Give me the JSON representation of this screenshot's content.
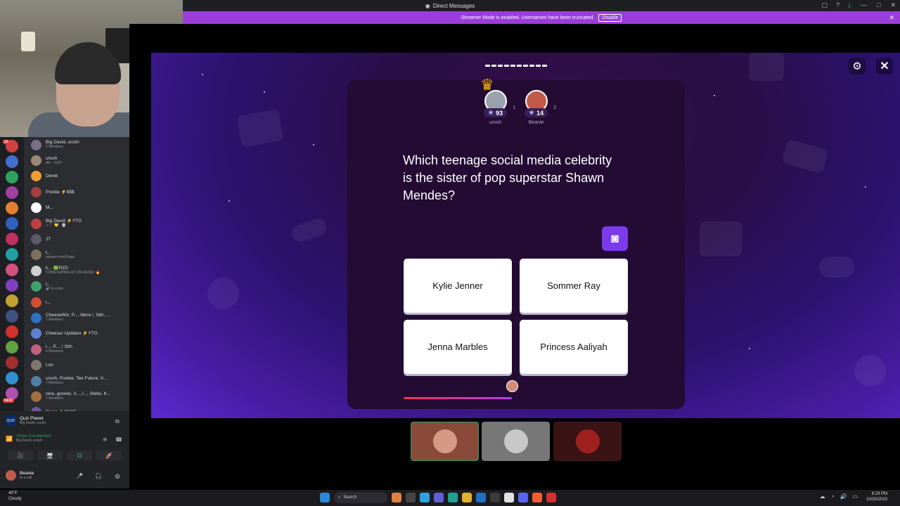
{
  "window": {
    "title": "Direct Messages",
    "controls": [
      "—",
      "□",
      "✕"
    ],
    "tools": [
      "▢",
      "?",
      "⤓"
    ]
  },
  "banner": {
    "text": "Streamer Mode is enabled. Usernames have been truncated.",
    "disable_label": "Disable",
    "close_label": "✕"
  },
  "dm_list": [
    {
      "name": "Big David, urosh",
      "sub": "3 Members",
      "color": "#7d6f8a"
    },
    {
      "name": "urosh",
      "sub": "🎮 ~ 1337",
      "color": "#9b8a7a"
    },
    {
      "name": "Derek",
      "sub": "",
      "color": "#f0a030"
    },
    {
      "name": "Pookie ⚡$$$",
      "sub": "",
      "color": "#a04040"
    },
    {
      "name": "M...",
      "sub": "",
      "color": "#ffffff"
    },
    {
      "name": "Big David ⚡YTG",
      "sub": "♫ ♪ · 💛 · 💀",
      "color": "#c04040"
    },
    {
      "name": "JT",
      "sub": "",
      "color": "#5a5a6a"
    },
    {
      "name": "t...",
      "sub": "passes.com/1lespi",
      "color": "#807060"
    },
    {
      "name": "k... 🟢RZD",
      "sub": "CODE KAPNALOT ON RAZED 🔥",
      "color": "#d0d0d0"
    },
    {
      "name": "t...",
      "sub": "🔊 In voice",
      "color": "#40a070"
    },
    {
      "name": "l...",
      "sub": "",
      "color": "#d05030"
    },
    {
      "name": "CheeseWiz, P..., Mere !, Sith, ...",
      "sub": "7 Members",
      "color": "#3070c0"
    },
    {
      "name": "Cheesur Updates ⚡YTG",
      "sub": "",
      "color": "#6080d0"
    },
    {
      "name": "l..., P..., ! Sith",
      "sub": "4 Members",
      "color": "#c06080"
    },
    {
      "name": "Lon",
      "sub": "",
      "color": "#807870"
    },
    {
      "name": "urosh, Pookie, Tee Future, V....",
      "sub": "7 Members",
      "color": "#5080a0"
    },
    {
      "name": "nine, gooner, V..., l..., Stello, K...",
      "sub": "7 Members",
      "color": "#a07040"
    },
    {
      "name": "Riyan ⚡TYCE",
      "sub": "",
      "color": "#6a5a9a"
    }
  ],
  "servers": [
    "#d04040",
    "#4070d0",
    "#30a060",
    "#a040a0",
    "#e08030",
    "#3060c0",
    "#c03060",
    "#20a0a0",
    "#d05080",
    "#8040c0",
    "#c0a030",
    "#405080",
    "#d03030",
    "#60a040",
    "#a03030",
    "#3090d0",
    "#b050b0"
  ],
  "server_badges": [
    "83",
    "NEW"
  ],
  "activity": {
    "name": "Quiz Planet",
    "members": "Big David, urosh",
    "voice_status": "Voice Connected",
    "voice_channel": "Big David, urosh",
    "buttons": [
      "🎥",
      "🖥",
      "⚃",
      "🚀"
    ]
  },
  "user": {
    "name": "Beanie",
    "status": "In a call",
    "controls": [
      "🎤",
      "🎧",
      "⚙"
    ]
  },
  "game": {
    "question": "Which teenage social media celebrity is the sister of pop superstar Shawn Mendes?",
    "answers": [
      "Kylie Jenner",
      "Sommer Ray",
      "Jenna Marbles",
      "Princess Aaliyah"
    ],
    "players": [
      {
        "name": "urosh",
        "score": "93",
        "rank": "1",
        "color": "#9aa3ad"
      },
      {
        "name": "Beanie",
        "score": "14",
        "rank": "2",
        "color": "#c25a4a"
      }
    ],
    "settings_icon": "⚙",
    "close_icon": "✕",
    "timer_progress": 0.48
  },
  "participants": [
    {
      "color": "#8a4a3a",
      "av": "#d59a86",
      "active": true
    },
    {
      "color": "#777777",
      "av": "#c8c8c8",
      "active": false
    },
    {
      "color": "#3a1414",
      "av": "#a02020",
      "active": false
    }
  ],
  "taskbar": {
    "weather_temp": "40°F",
    "weather_desc": "Cloudy",
    "search_placeholder": "Search",
    "time": "8:29 PM",
    "date": "10/30/2023"
  }
}
